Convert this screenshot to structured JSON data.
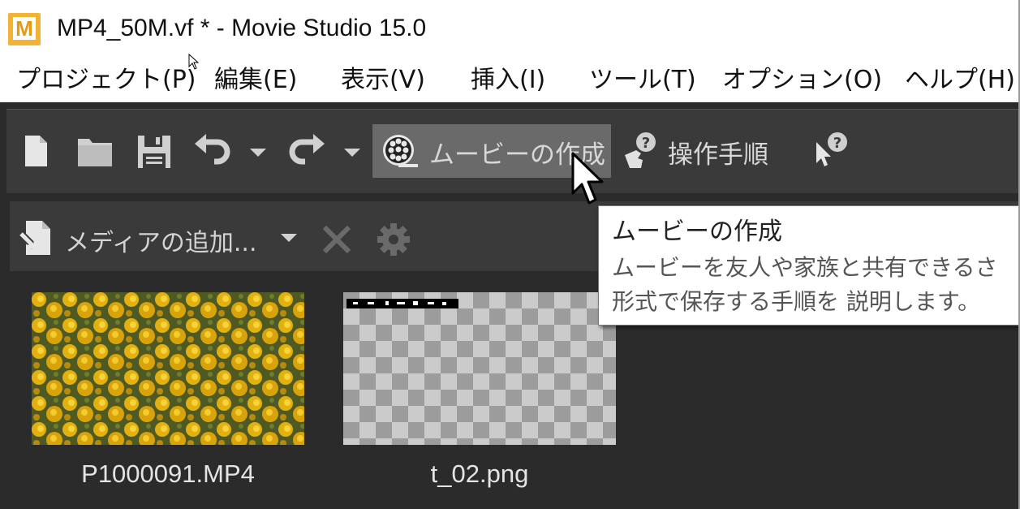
{
  "window": {
    "app_icon_letter": "M",
    "title": "MP4_50M.vf * - Movie Studio 15.0"
  },
  "menu": {
    "items": [
      {
        "label": "プロジェクト(P)"
      },
      {
        "label": "編集(E)"
      },
      {
        "label": "表示(V)"
      },
      {
        "label": "挿入(I)"
      },
      {
        "label": "ツール(T)"
      },
      {
        "label": "オプション(O)"
      },
      {
        "label": "ヘルプ(H)"
      }
    ]
  },
  "toolbar": {
    "icons": [
      "new-file-icon",
      "open-folder-icon",
      "save-icon",
      "undo-icon",
      "undo-dropdown-icon",
      "redo-icon",
      "redo-dropdown-icon"
    ],
    "make_movie_label": "ムービーの作成",
    "guide_label": "操作手順",
    "help_icon": "context-help-icon",
    "highlight_color": "#6a6a6a"
  },
  "media_bar": {
    "add_media_label": "メディアの追加...",
    "icons": [
      "add-media-icon",
      "dropdown-icon",
      "remove-icon",
      "settings-gear-icon"
    ]
  },
  "media": [
    {
      "filename": "P1000091.MP4"
    },
    {
      "filename": "t_02.png"
    }
  ],
  "tooltip": {
    "title": "ムービーの作成",
    "line1": "ムービーを友人や家族と共有できるさ",
    "line2": "形式で保存する手順を 説明します。"
  },
  "colors": {
    "panel": "#3a3a3a",
    "background": "#2b2b2b",
    "text_light": "#d8d8d8",
    "app_icon": "#f2b233"
  }
}
